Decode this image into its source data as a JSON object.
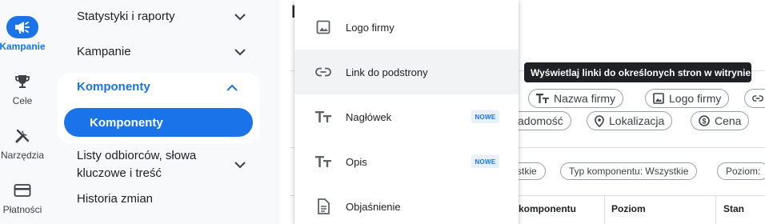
{
  "rail": {
    "items": [
      {
        "label": "Kampanie",
        "icon": "megaphone-icon",
        "active": true
      },
      {
        "label": "Cele",
        "icon": "trophy-icon",
        "active": false
      },
      {
        "label": "Narzędzia",
        "icon": "tools-icon",
        "active": false
      },
      {
        "label": "Płatności",
        "icon": "credit-card-icon",
        "active": false
      }
    ]
  },
  "nav": {
    "stats": "Statystyki i raporty",
    "campaigns": "Kampanie",
    "components_group": "Komponenty",
    "components_sub": "Komponenty",
    "audiences_line1": "Listy odbiorców, słowa",
    "audiences_line2": "kluczowe i treść",
    "history": "Historia zmian"
  },
  "main": {
    "title_partial": "K",
    "chips_row1": [
      "Nazwa firmy",
      "Logo firmy"
    ],
    "chips_row2": [
      "adomość",
      "Lokalizacja",
      "Cena"
    ],
    "filters": [
      "stkie",
      "Typ komponentu: Wszystkie",
      "Poziom:"
    ],
    "table_headers": [
      "komponentu",
      "Poziom",
      "Stan"
    ]
  },
  "menu": {
    "items": [
      {
        "label": "Logo firmy",
        "icon": "image-icon",
        "badge": ""
      },
      {
        "label": "Link do podstrony",
        "icon": "link-icon",
        "badge": ""
      },
      {
        "label": "Nagłówek",
        "icon": "text-type-icon",
        "badge": "NOWE"
      },
      {
        "label": "Opis",
        "icon": "text-type-icon",
        "badge": "NOWE"
      },
      {
        "label": "Objaśnienie",
        "icon": "document-icon",
        "badge": ""
      }
    ]
  },
  "tooltip": {
    "text": "Wyświetlaj linki do określonych stron w witrynie"
  },
  "colors": {
    "accent": "#1a73e8",
    "tooltip_bg": "#202124",
    "hover": "#f1f3f4",
    "badge_bg": "#e8f0fe"
  }
}
